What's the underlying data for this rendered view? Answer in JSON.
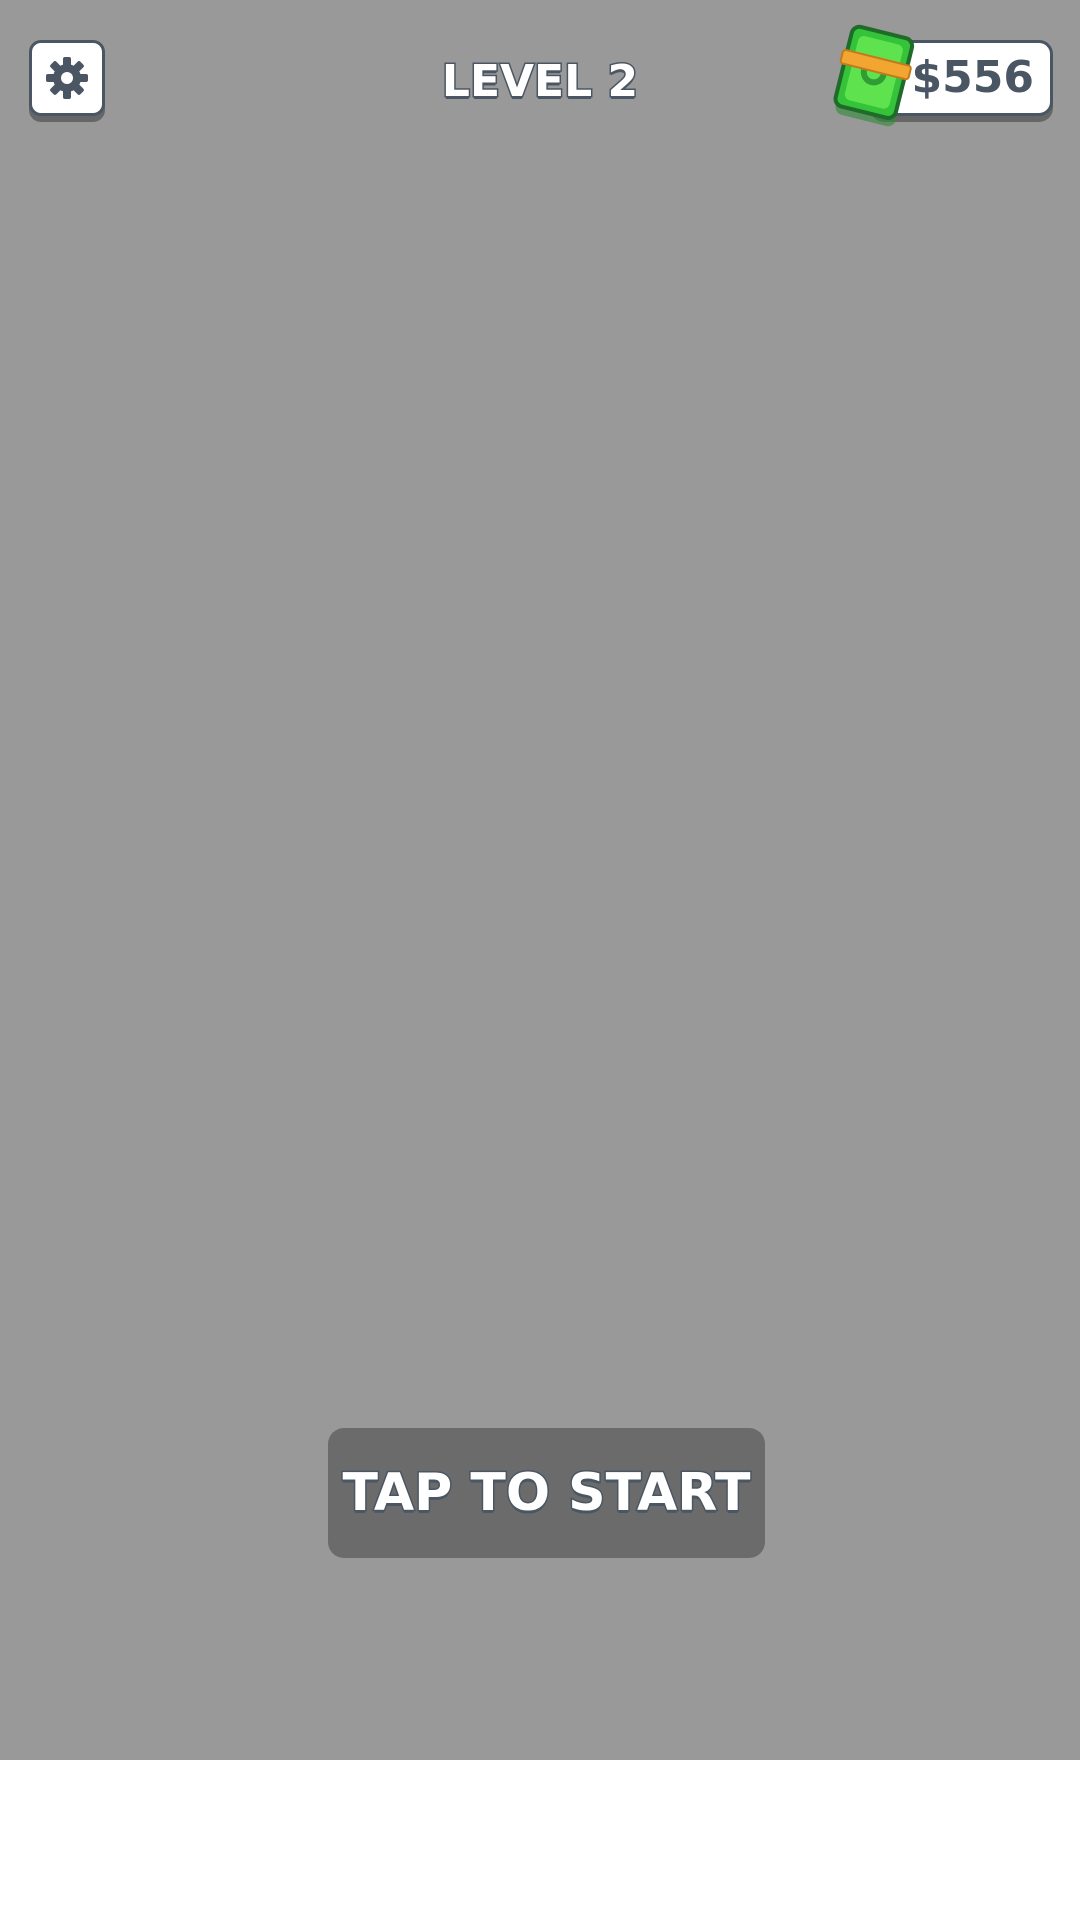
{
  "hud": {
    "level_label": "LEVEL 2",
    "money_label": "$556",
    "settings_icon": "gear-icon",
    "money_icon": "cash-stack-icon"
  },
  "start": {
    "label": "TAP TO START"
  },
  "colors": {
    "background": "#999999",
    "outline": "#4a5663",
    "start_button": "#6b6b6b",
    "cash_green": "#35c33a",
    "cash_band": "#f2a531"
  }
}
